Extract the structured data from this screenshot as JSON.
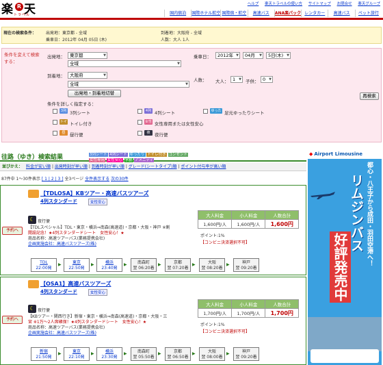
{
  "header": {
    "logo_kanji1": "楽",
    "logo_r": "R",
    "logo_kanji2": "天",
    "logo_sub": "トラベル",
    "top_links": [
      "ヘルプ",
      "楽天トラベルの使い方",
      "サイトマップ",
      "お問合せ",
      "楽天グループ"
    ],
    "nav": [
      "国内宿泊",
      "国際ホテル航空",
      "国際宿・航空",
      "高速バス",
      "ANA楽パック",
      "レンタカー",
      "高速バス",
      "ペット旅行"
    ]
  },
  "current": {
    "title": "現在の検索条件：",
    "depart": "出発地：東京都 - 全域",
    "arrive": "到着地：大阪府 - 全域",
    "date": "乗車日：2012年 04月 05日 (木)",
    "people": "人数：大人 1人"
  },
  "search": {
    "side_label": "条件を変えて検索する：",
    "depart_label": "出発地：",
    "depart_pref": "東京都",
    "depart_area": "全域",
    "arrive_label": "到着地：",
    "arrive_pref": "大阪府",
    "arrive_area": "全域",
    "swap_button": "出発地・到着地切替",
    "date_label": "乗車日：",
    "year": "2012年",
    "month": "04月",
    "day": "5日(木)",
    "people_label": "人数：",
    "adult_label": "大人：",
    "adult_val": "1",
    "child_label": "子供：",
    "child_val": "0",
    "search_button": "再検索",
    "cond_label": "条件を詳しく指定する：",
    "options": [
      {
        "icon": "3列",
        "label": "3列シート",
        "color": "#5b8ee0"
      },
      {
        "icon": "4列",
        "label": "4列シート",
        "color": "#7c6fd8"
      },
      {
        "icon": "ゆったり",
        "label": "足元ゆったりシート",
        "color": "#3c9ad8"
      },
      {
        "icon": "トイレ",
        "label": "トイレ付き",
        "color": "#c28f2c"
      },
      {
        "icon": "女性",
        "label": "女性専用または女性安心",
        "color": "#e0608a"
      },
      {
        "icon": "昼",
        "label": "昼行便",
        "color": "#e08a2c"
      },
      {
        "icon": "夜",
        "label": "夜行便",
        "color": "#334"
      }
    ]
  },
  "results": {
    "title": "往路（ゆき）検索結果",
    "chips": [
      "3列シート",
      "4列シート",
      "ゆったり",
      "トイレ付き",
      "コンセント",
      "女性専用",
      "女性安心",
      "学割",
      "アメニティ"
    ],
    "sort_head": "並びかえ：",
    "sorts": [
      "料金が安い順",
      "出発時刻が早い順",
      "到着時刻が早い順",
      "グレード(シートタイプ)順",
      "ポイント付与率が高い順"
    ],
    "pager_text": "87件中 1〜30件表示",
    "pager_pages": "[ 1 | 2 | 3 ]",
    "pager_total": "全3ページ",
    "pager_all": "全件表示する",
    "pager_next": "次の30件"
  },
  "cards": [
    {
      "reserve": "予約へ",
      "name": "【TDLOSA】KBツアー・高速バスツアーズ",
      "seat": "4列スタンダード",
      "tag": "女性安心",
      "night_label": "夜行便",
      "desc1": "【TDLスペシャル】TDL・東京・横浜⇒南森(高速道)・京都・大阪・神戸 ※割",
      "desc2": "開設記念！★4列スタンダードシート　女性安心！★",
      "desc3": "商品名称：高速ツアーバス(業務提携会社)",
      "desc4": "企画実施会社：高速バスツアーズ(株)",
      "price_headers": [
        "大人料金",
        "小人料金",
        "人数合計"
      ],
      "prices": [
        "1,600円/人",
        "1,600円/人",
        "1,600円"
      ],
      "point": "ポイント:1%",
      "conv": "【コンビニ決済選択不可】",
      "stops": [
        {
          "name": "TDL",
          "time": "22:00発",
          "on": true
        },
        {
          "name": "東京",
          "time": "22:50発",
          "on": true
        },
        {
          "name": "横浜",
          "time": "23:40発",
          "on": true
        },
        {
          "name": "南森町",
          "time": "翌 06:20着",
          "on": false
        },
        {
          "name": "京都",
          "time": "翌 07:20着",
          "on": false
        },
        {
          "name": "大阪",
          "time": "翌 08:20着",
          "on": false
        },
        {
          "name": "神戸",
          "time": "翌 09:20着",
          "on": false
        }
      ]
    },
    {
      "reserve": "予約へ",
      "name": "【OSA1】高速バスツアーズ",
      "seat": "4列スタンダード",
      "tag": "女性安心",
      "night_label": "夜行便",
      "desc1": "【KBツアー・関西行き】新宿・東京・横浜⇒南森(高速道)・京都・大阪・三",
      "desc2": "宮 ※1万〜2人席確保！★4列スタンダードシート　女性安心！★",
      "desc3": "商品名称：高速ツアーバス(業務提携会社)",
      "desc4": "企画実施会社：高速バスツアーズ(株)",
      "price_headers": [
        "大人料金",
        "小人料金",
        "人数合計"
      ],
      "prices": [
        "1,700円/人",
        "1,700円/人",
        "1,700円"
      ],
      "point": "ポイント:1%",
      "conv": "【コンビニ決済選択不可】",
      "stops": [
        {
          "name": "新宿",
          "time": "21:50発",
          "on": true
        },
        {
          "name": "東京",
          "time": "22:10発",
          "on": true
        },
        {
          "name": "横浜",
          "time": "23:30発",
          "on": true
        },
        {
          "name": "南森町",
          "time": "翌 05:50着",
          "on": false
        },
        {
          "name": "京都",
          "time": "翌 06:50着",
          "on": false
        },
        {
          "name": "大阪",
          "time": "翌 08:00着",
          "on": false
        },
        {
          "name": "神戸",
          "time": "翌 09:20着",
          "on": false
        }
      ]
    }
  ],
  "ad": {
    "head_brand": "Airport Limousine",
    "line1": "都心・八王子から成田・羽田空港へ！",
    "line2": "リムジンバス",
    "line3": "好評発売中"
  }
}
